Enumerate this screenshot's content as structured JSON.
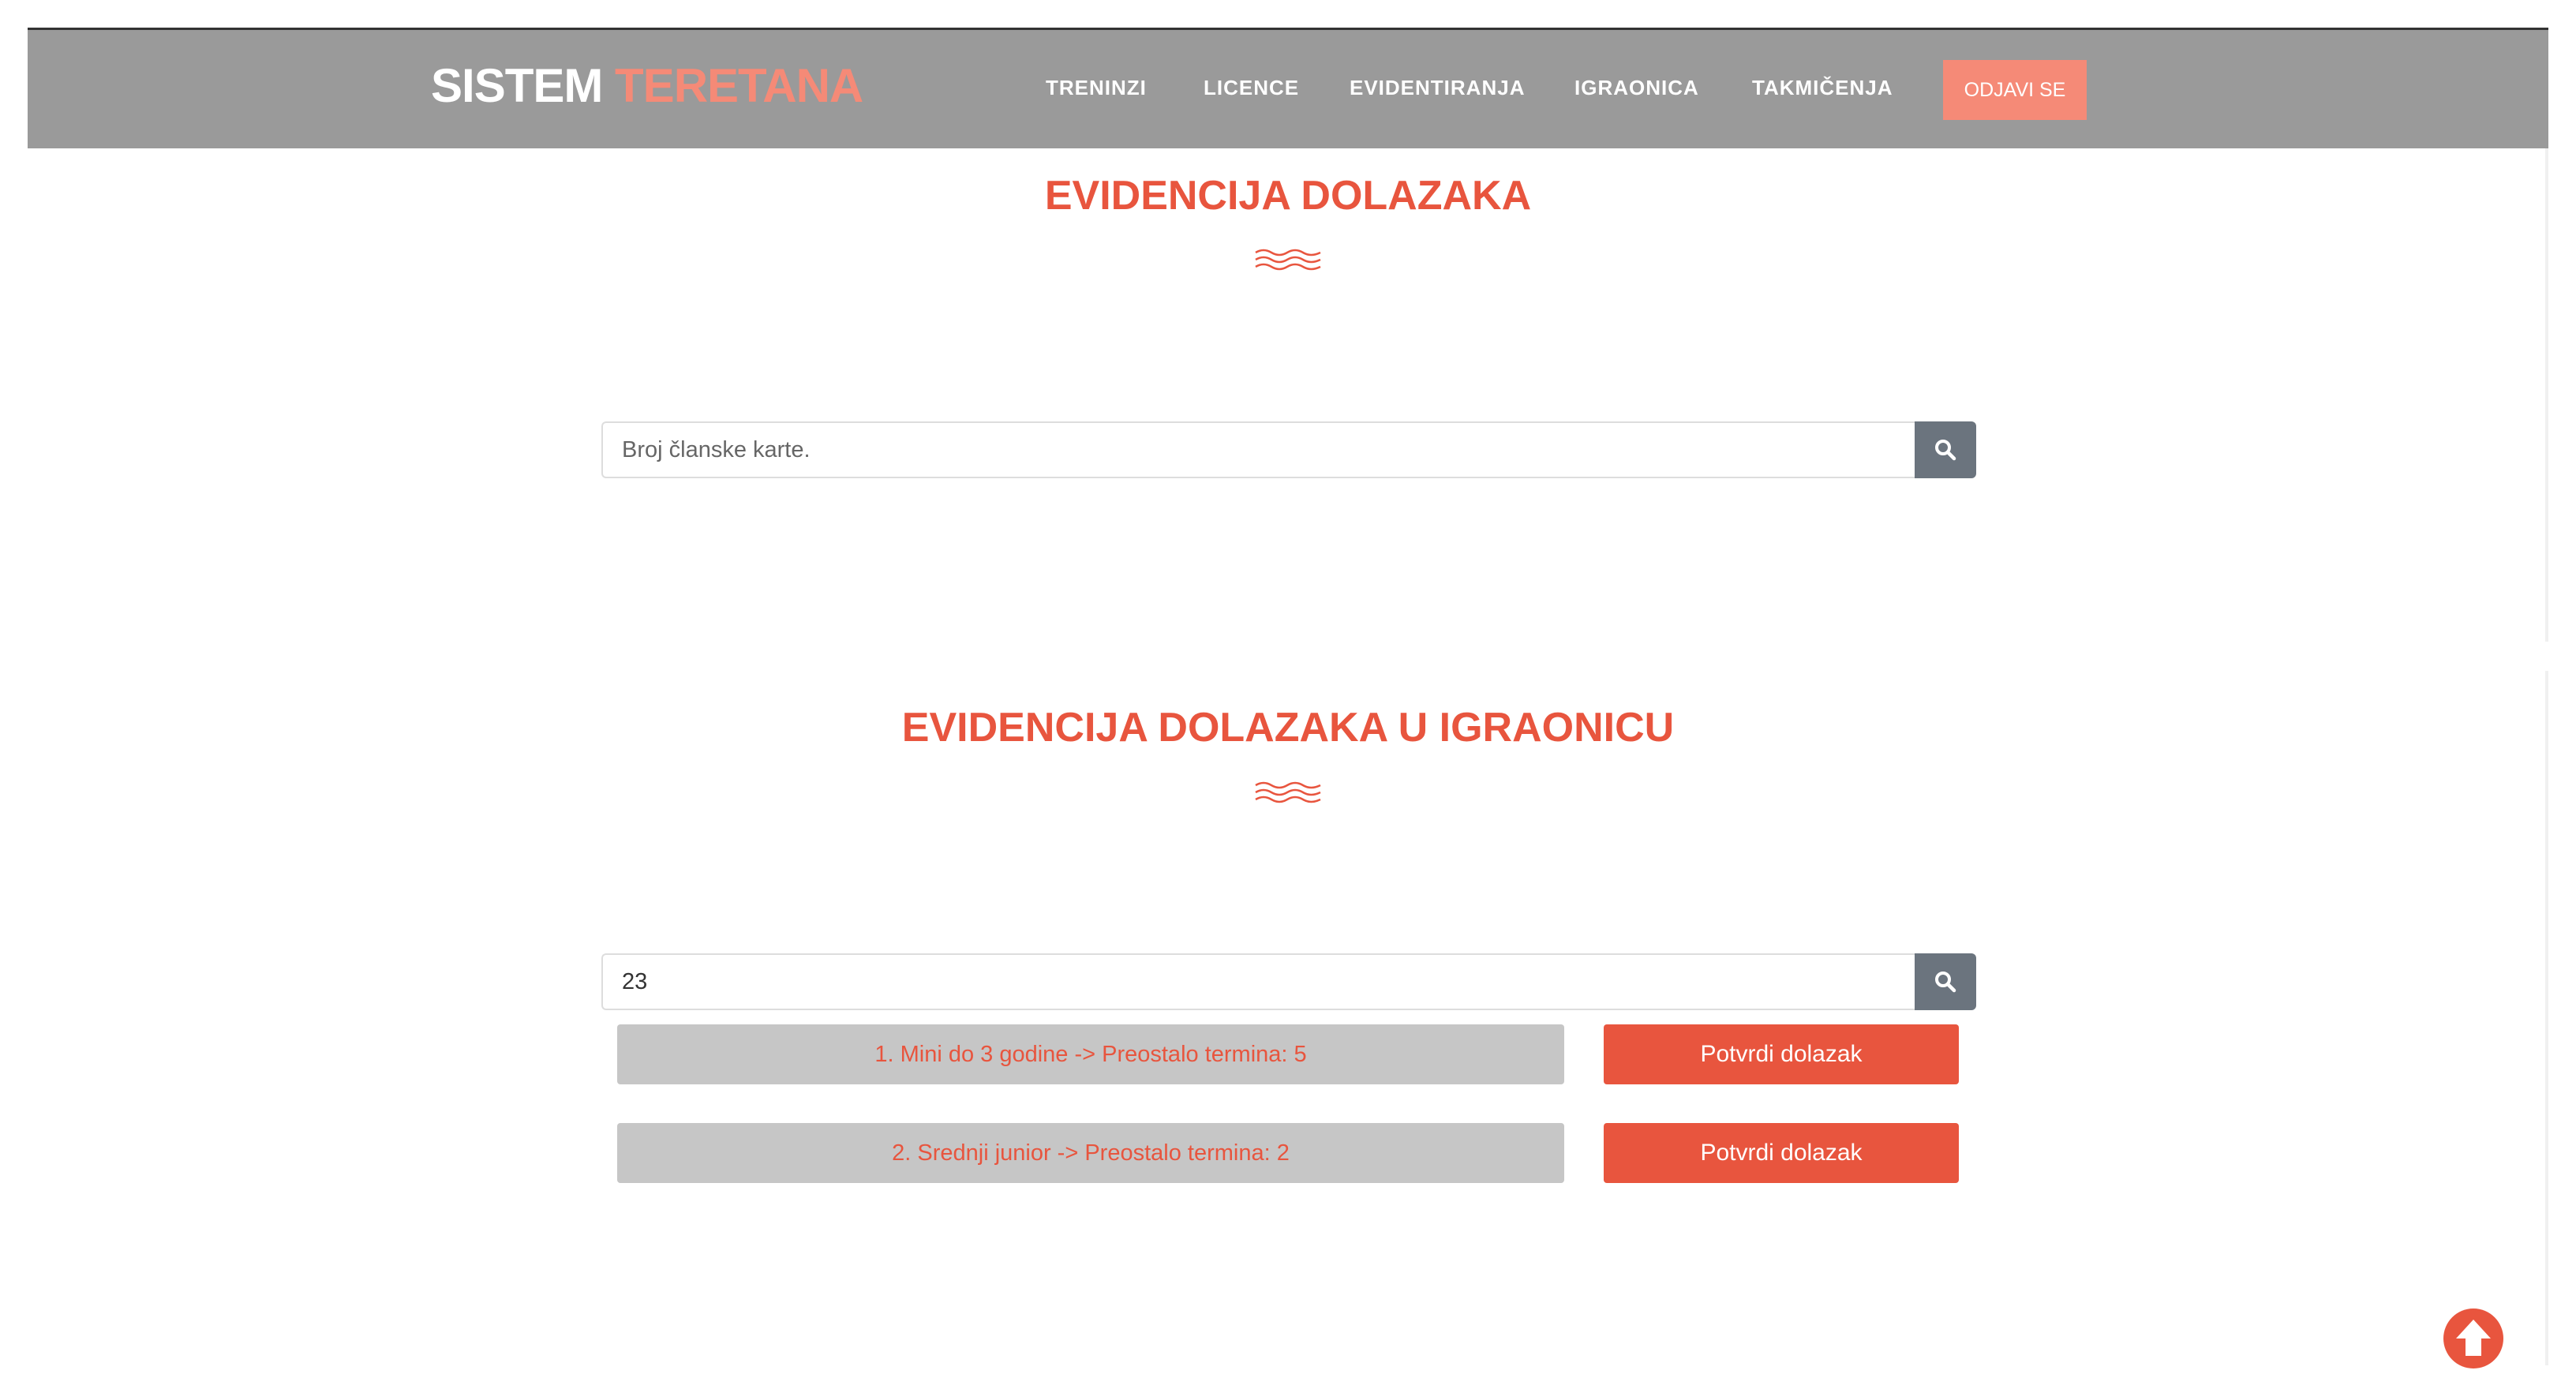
{
  "brand": {
    "part1": "SISTEM",
    "part2": "TERETANA"
  },
  "nav": {
    "items": [
      {
        "label": "TRENINZI"
      },
      {
        "label": "LICENCE"
      },
      {
        "label": "EVIDENTIRANJA"
      },
      {
        "label": "IGRAONICA"
      },
      {
        "label": "TAKMIČENJA"
      }
    ],
    "logout_label": "ODJAVI SE"
  },
  "section1": {
    "title": "EVIDENCIJA DOLAZAKA",
    "search": {
      "placeholder": "Broj članske karte.",
      "value": ""
    }
  },
  "section2": {
    "title": "EVIDENCIJA DOLAZAKA U IGRAONICU",
    "search": {
      "placeholder": "",
      "value": "23"
    },
    "packages": [
      {
        "label": "1. Mini do 3 godine -> Preostalo termina: 5",
        "button_label": "Potvrdi dolazak"
      },
      {
        "label": "2. Srednji junior -> Preostalo termina: 2",
        "button_label": "Potvrdi dolazak"
      }
    ]
  },
  "icons": {
    "search": "search-icon",
    "wave": "wave-divider-icon",
    "scroll_top": "arrow-up-circle-icon"
  },
  "colors": {
    "navbar": "#9a9a9a",
    "accent": "#e8553e",
    "accent_light": "#f58a77",
    "search_button": "#6b747e",
    "package_bg": "#c6c6c6"
  }
}
